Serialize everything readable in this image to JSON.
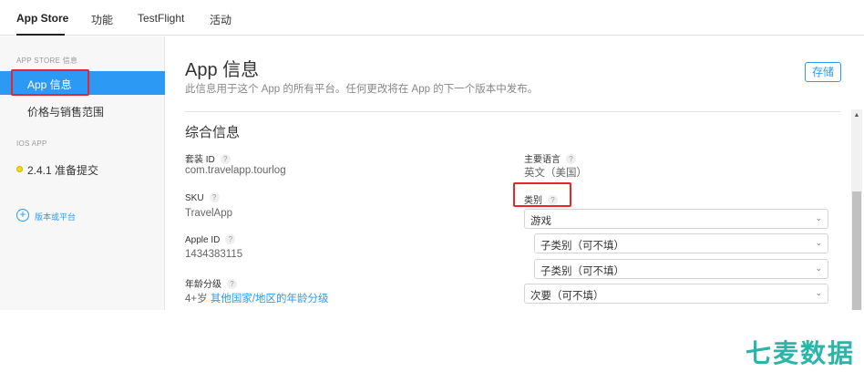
{
  "topnav": {
    "tabs": [
      {
        "label": "App Store"
      },
      {
        "label": "功能"
      },
      {
        "label": "TestFlight"
      },
      {
        "label": "活动"
      }
    ]
  },
  "sidebar": {
    "section1_header": "APP STORE 信息",
    "items": [
      {
        "label": "App 信息"
      },
      {
        "label": "价格与销售范围"
      }
    ],
    "section2_header": "IOS APP",
    "version_item": "2.4.1 准备提交",
    "add_label": "版本或平台"
  },
  "main": {
    "title": "App 信息",
    "description": "此信息用于这个 App 的所有平台。任何更改将在 App 的下一个版本中发布。",
    "save_label": "存储",
    "section_title": "综合信息",
    "help": "?",
    "fields": {
      "bundle_id_label": "套装 ID",
      "bundle_id_value": "com.travelapp.tourlog",
      "sku_label": "SKU",
      "sku_value": "TravelApp",
      "apple_id_label": "Apple ID",
      "apple_id_value": "1434383115",
      "age_label": "年龄分级",
      "age_value": "4+岁",
      "age_link": "其他国家/地区的年龄分级",
      "language_label": "主要语言",
      "language_value": "英文（美国）",
      "category_label": "类别",
      "primary_category": "游戏",
      "subcategory1": "子类别（可不填）",
      "subcategory2": "子类别（可不填）",
      "secondary_category": "次要（可不填）"
    },
    "chevron": "⌄"
  },
  "watermark": "七麦数据",
  "colors": {
    "accent": "#2c9af4",
    "highlight_box": "#e8262a",
    "watermark": "#2bb5a6"
  }
}
